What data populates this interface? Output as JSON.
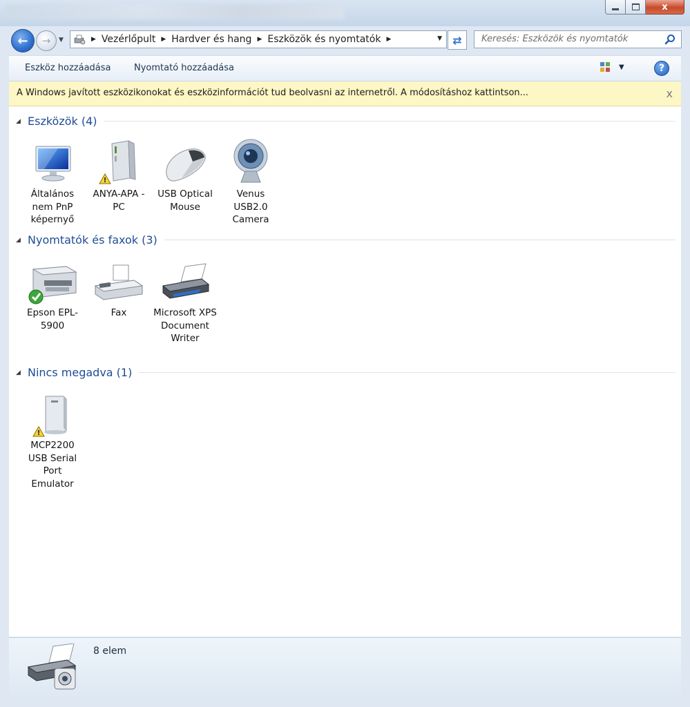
{
  "window": {
    "close_glyph": "x"
  },
  "nav": {
    "breadcrumb": [
      "Vezérlőpult",
      "Hardver és hang",
      "Eszközök és nyomtatók"
    ],
    "search_placeholder": "Keresés: Eszközök és nyomtatók"
  },
  "toolbar": {
    "add_device": "Eszköz hozzáadása",
    "add_printer": "Nyomtató hozzáadása",
    "help": "?"
  },
  "infobar": {
    "text": "A Windows javított eszközikonokat és eszközinformációt tud beolvasni az internetről. A módosításhoz kattintson...",
    "close": "x"
  },
  "groups": [
    {
      "title": "Eszközök (4)",
      "items": [
        {
          "label": "Általános nem PnP képernyő",
          "icon": "monitor-icon"
        },
        {
          "label": "ANYA-APA -PC",
          "icon": "computer-tower-icon",
          "warning": true
        },
        {
          "label": "USB Optical Mouse",
          "icon": "mouse-icon"
        },
        {
          "label": "Venus USB2.0 Camera",
          "icon": "webcam-icon"
        }
      ]
    },
    {
      "title": "Nyomtatók és faxok (3)",
      "items": [
        {
          "label": "Epson EPL-5900",
          "icon": "printer-icon",
          "default": true
        },
        {
          "label": "Fax",
          "icon": "fax-icon"
        },
        {
          "label": "Microsoft XPS Document Writer",
          "icon": "printer-icon"
        }
      ]
    },
    {
      "title": "Nincs megadva (1)",
      "items": [
        {
          "label": "MCP2200 USB Serial Port Emulator",
          "icon": "device-box-icon",
          "warning": true
        }
      ]
    }
  ],
  "details": {
    "count": "8 elem"
  },
  "colors": {
    "group_title": "#1e4c95",
    "infobar": "#fdf6c5",
    "link": "#1f3550"
  }
}
